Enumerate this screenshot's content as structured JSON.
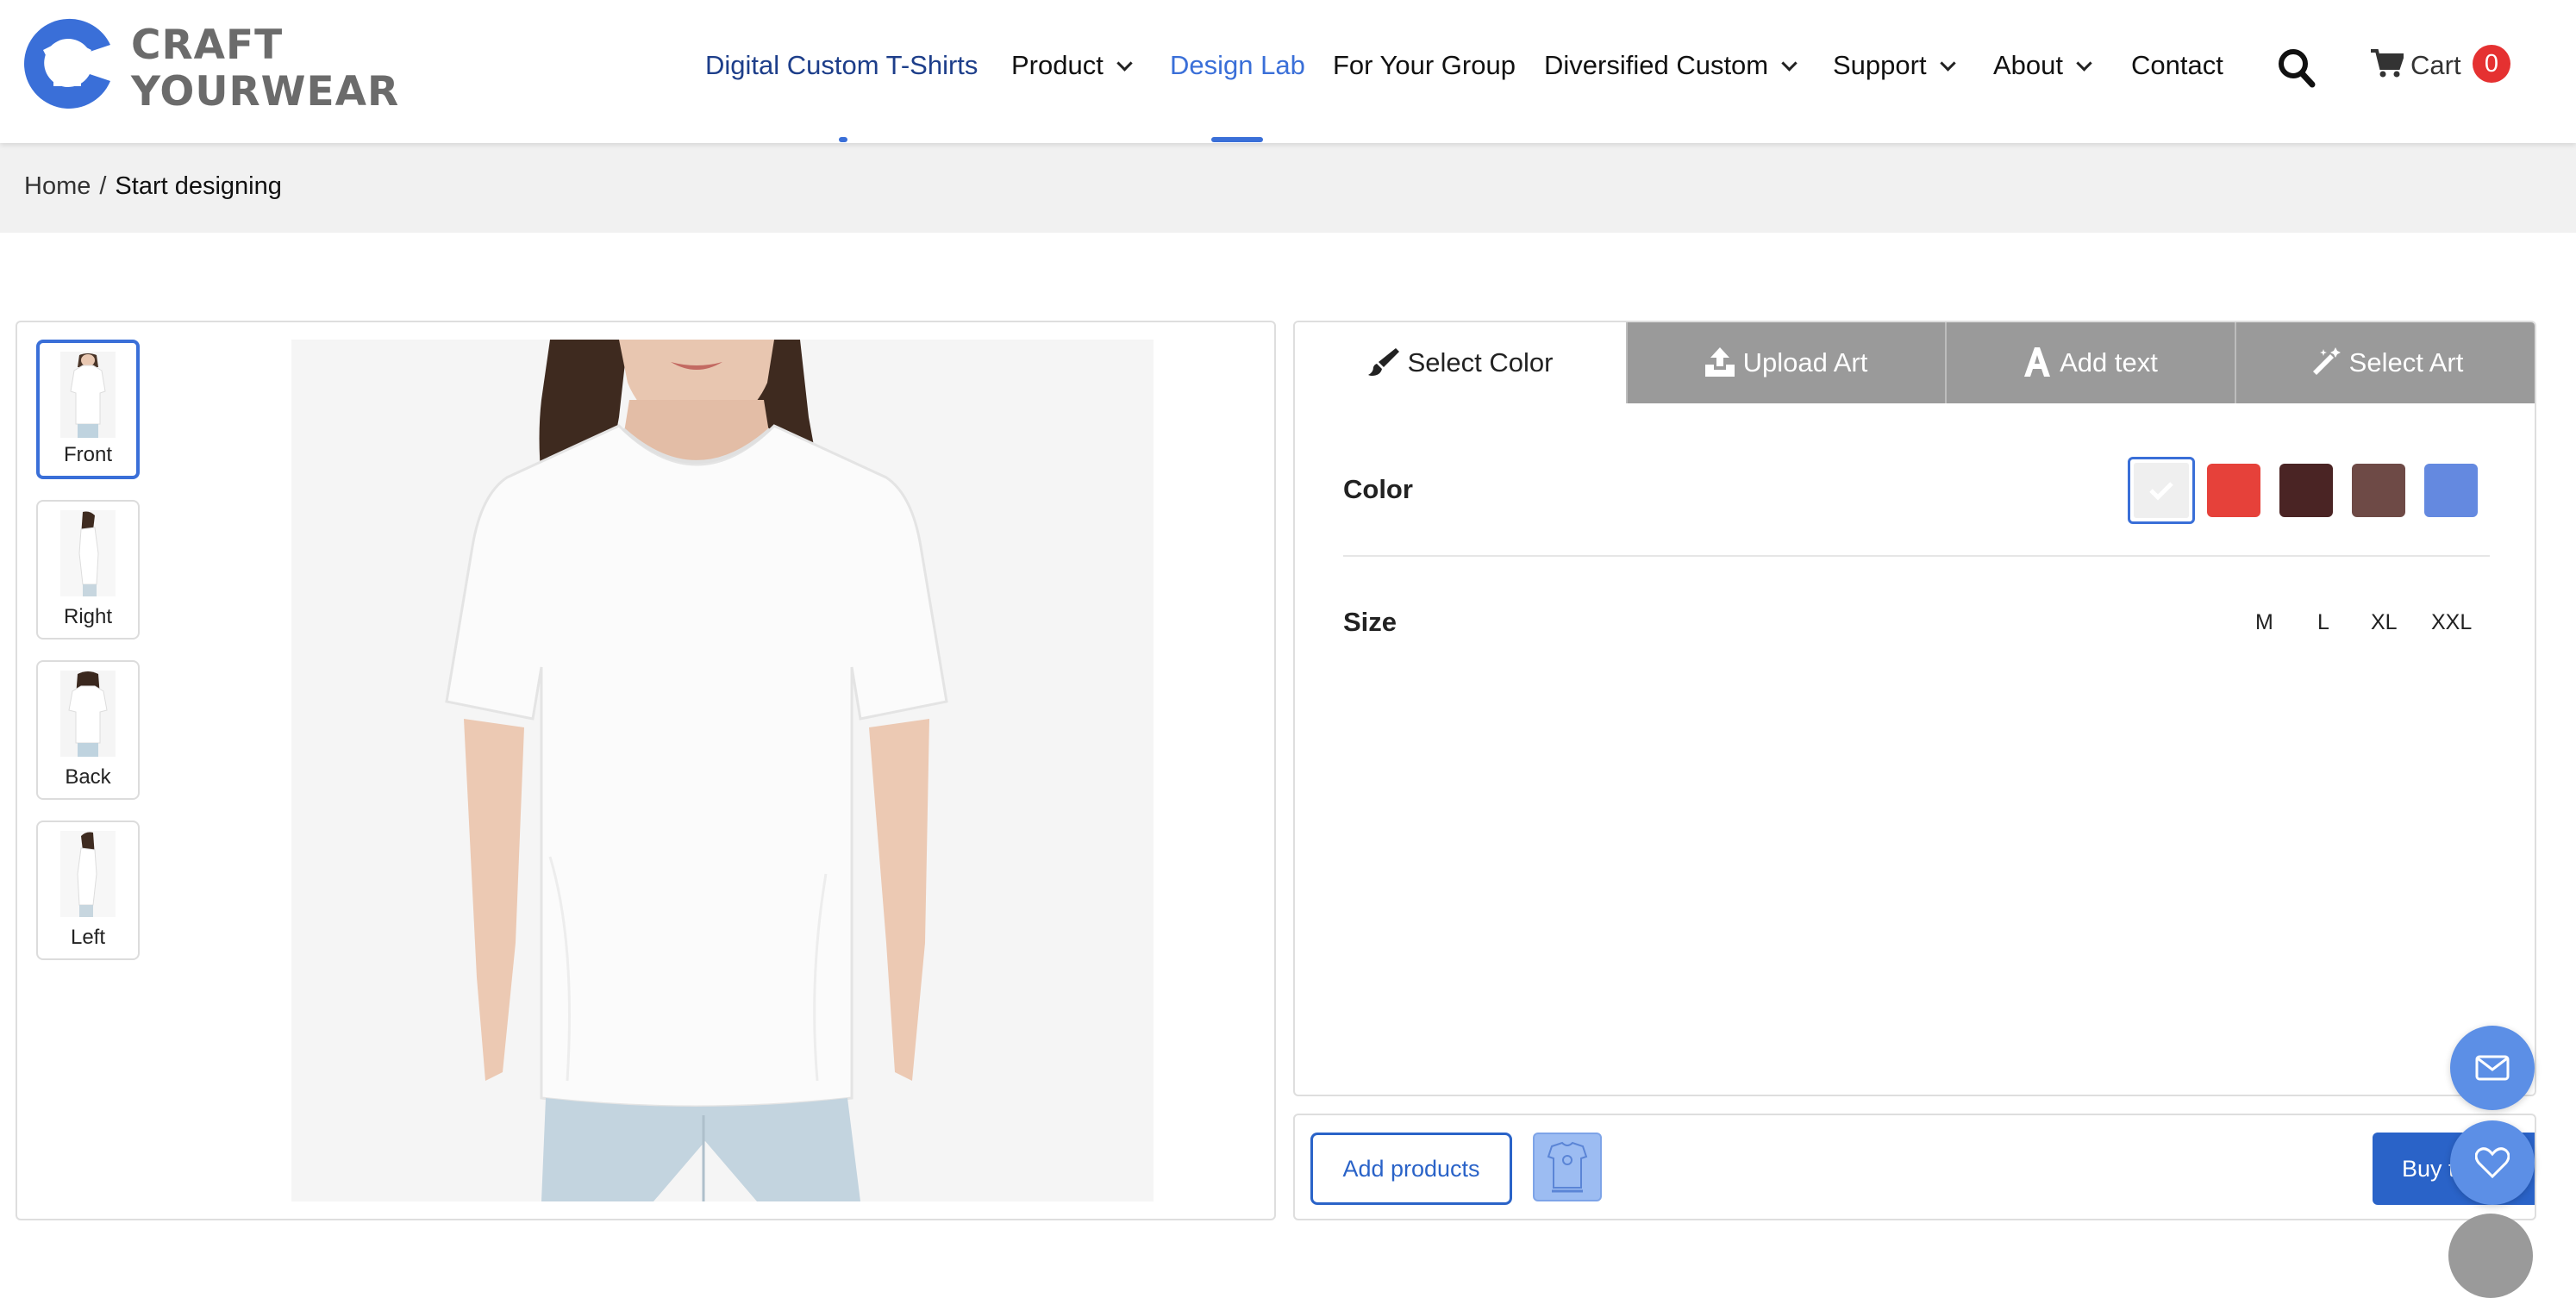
{
  "brand": {
    "line1": "CRAFT",
    "line2": "YOURWEAR"
  },
  "nav": {
    "items": [
      {
        "label": "Digital Custom T-Shirts",
        "dropdown": false
      },
      {
        "label": "Product",
        "dropdown": true
      },
      {
        "label": "Design Lab",
        "dropdown": false,
        "active": true
      },
      {
        "label": "For Your Group",
        "dropdown": false
      },
      {
        "label": "Diversified Custom",
        "dropdown": true
      },
      {
        "label": "Support",
        "dropdown": true
      },
      {
        "label": "About",
        "dropdown": true
      },
      {
        "label": "Contact",
        "dropdown": false
      }
    ],
    "cart_label": "Cart",
    "cart_count": "0"
  },
  "breadcrumb": {
    "home": "Home",
    "separator": "/",
    "current": "Start designing"
  },
  "views": [
    {
      "label": "Front",
      "active": true
    },
    {
      "label": "Right"
    },
    {
      "label": "Back"
    },
    {
      "label": "Left"
    }
  ],
  "tabs": [
    {
      "label": "Select Color",
      "icon": "paint-brush-icon",
      "active": true
    },
    {
      "label": "Upload Art",
      "icon": "upload-icon"
    },
    {
      "label": "Add text",
      "icon": "font-letter-icon"
    },
    {
      "label": "Select Art",
      "icon": "magic-wand-icon"
    }
  ],
  "color_section": {
    "label": "Color",
    "swatches": [
      "#efefef",
      "#e6413a",
      "#4a2424",
      "#6e4a46",
      "#6489e0"
    ],
    "selected_index": 0
  },
  "size_section": {
    "label": "Size",
    "sizes": [
      "M",
      "L",
      "XL",
      "XXL"
    ]
  },
  "bottom": {
    "add_products": "Add products",
    "buy_label": "Buy t"
  },
  "colors": {
    "accent": "#3a6fd8",
    "button": "#2a63c8",
    "badge": "#e53131",
    "tab_inactive": "#9a9a9a"
  }
}
